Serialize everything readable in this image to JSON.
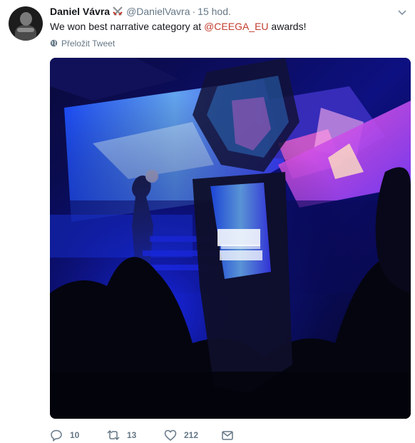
{
  "author": {
    "name": "Daniel Vávra",
    "handle": "@DanielVavra",
    "separator": "·",
    "time": "15 hod."
  },
  "tweet": {
    "text_before": "We won best narrative category at ",
    "mention": "@CEEGA_EU",
    "text_after": " awards!",
    "translate_label": "Přeložit Tweet"
  },
  "actions": {
    "replies": "10",
    "retweets": "13",
    "likes": "212"
  },
  "colors": {
    "mention": "#c33c2e",
    "muted": "#657786"
  },
  "icons": [
    "crossed-swords-icon",
    "chevron-down-icon",
    "globe-icon",
    "reply-icon",
    "retweet-icon",
    "like-icon",
    "message-icon"
  ]
}
